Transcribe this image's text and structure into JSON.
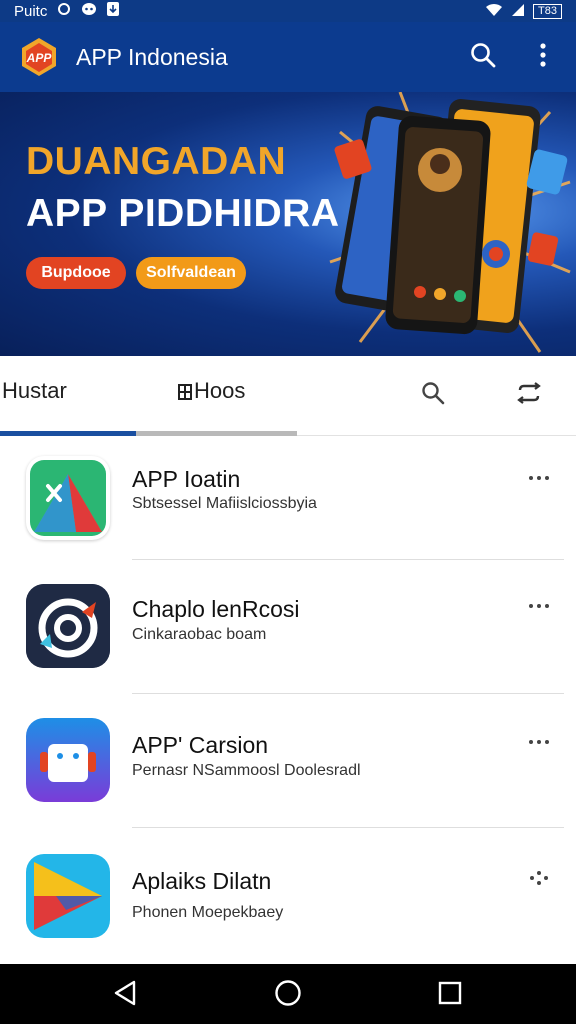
{
  "status_bar": {
    "carrier": "Puitc",
    "battery": "T83"
  },
  "app_bar": {
    "logo_text": "APP",
    "title": "APP Indonesia"
  },
  "banner": {
    "headline_1": "DUANGADAN",
    "headline_2": "APP PIDDHIDRA",
    "button_1": "Bupdooe",
    "button_2": "Solfvaldean"
  },
  "tabs": [
    {
      "label": "Hustar",
      "selected": true
    },
    {
      "label": "Hoos",
      "selected": false
    }
  ],
  "apps": [
    {
      "name": "APP Ioatin",
      "subtitle": "Sbtsessel Mafiislciossbyia"
    },
    {
      "name": "Chaplo lenRcosi",
      "subtitle": "Cinkaraobac boam"
    },
    {
      "name": "APP' Carsion",
      "subtitle": "Pernasr NSammoosl Doolesradl"
    },
    {
      "name": "Aplaiks Dilatn",
      "subtitle": "Phonen Moepekbaey"
    }
  ],
  "colors": {
    "primary": "#0c3b8f",
    "accent_orange": "#f1a62a",
    "accent_red": "#e24422",
    "tab_indicator": "#1a4fa0"
  },
  "icons": [
    "search-icon",
    "more-vert-icon",
    "repeat-icon",
    "back-icon",
    "home-icon",
    "recents-icon"
  ]
}
